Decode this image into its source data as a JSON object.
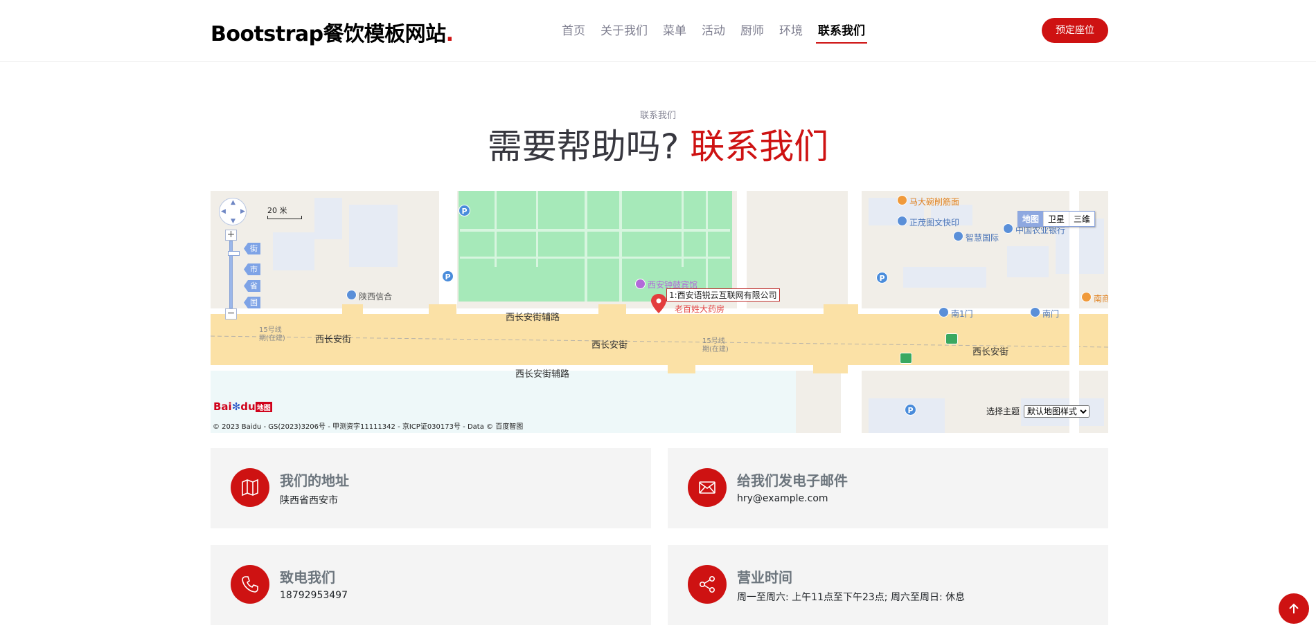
{
  "header": {
    "logo": "Bootstrap餐饮模板网站",
    "logo_dot": ".",
    "nav": [
      {
        "label": "首页",
        "active": false
      },
      {
        "label": "关于我们",
        "active": false
      },
      {
        "label": "菜单",
        "active": false
      },
      {
        "label": "活动",
        "active": false
      },
      {
        "label": "厨师",
        "active": false
      },
      {
        "label": "环境",
        "active": false
      },
      {
        "label": "联系我们",
        "active": true
      }
    ],
    "book_button": "预定座位"
  },
  "section": {
    "eyebrow": "联系我们",
    "title_main": "需要帮助吗?",
    "title_accent": "联系我们"
  },
  "map": {
    "scale_label": "20 米",
    "zoom_in": "+",
    "zoom_out": "−",
    "level_tags": [
      "街",
      "市",
      "省",
      "国"
    ],
    "map_types": [
      "地图",
      "卫星",
      "三维"
    ],
    "active_map_type": "地图",
    "marker_label": "1:西安语锐云互联网有限公司",
    "labels": {
      "hotel": "西安钟鼓宾馆",
      "pharmacy": "老百姓大药房",
      "noodles": "马大碗削筋面",
      "photo": "正茂图文快印",
      "zhihui": "智慧国际",
      "bank": "中国农业银行",
      "credit": "陕西信合",
      "south_gate_1": "南1门",
      "south_gate": "南门",
      "aux_road_top": "西长安街辅路",
      "aux_road_bottom": "西长安街辅路",
      "main_road_left": "西长安街",
      "main_road_center": "西长安街",
      "main_road_right": "西长安街",
      "metro_left_1": "15号线",
      "metro_left_2": "期(在建)",
      "metro_mid_1": "15号线",
      "metro_mid_2": "期(在建)",
      "edge_right": "南商"
    },
    "baidu_logo_a": "Bai",
    "baidu_logo_b": "du",
    "baidu_logo_chip": "地图",
    "copyright": "© 2023 Baidu - GS(2023)3206号 - 甲测资字11111342 - 京ICP证030173号 - Data © 百度智图",
    "theme_label": "选择主题",
    "theme_value": "默认地图样式"
  },
  "cards": [
    {
      "title": "我们的地址",
      "text": "陕西省西安市",
      "icon": "map-icon"
    },
    {
      "title": "给我们发电子邮件",
      "text": "hry@example.com",
      "icon": "envelope-icon"
    },
    {
      "title": "致电我们",
      "text": "18792953497",
      "icon": "phone-icon"
    },
    {
      "title": "营业时间",
      "text": "周一至周六:  上午11点至下午23点;  周六至周日:  休息",
      "icon": "share-icon"
    }
  ],
  "colors": {
    "accent": "#ce1212",
    "card_bg": "#f4f4f4",
    "muted": "#7f7f90"
  }
}
